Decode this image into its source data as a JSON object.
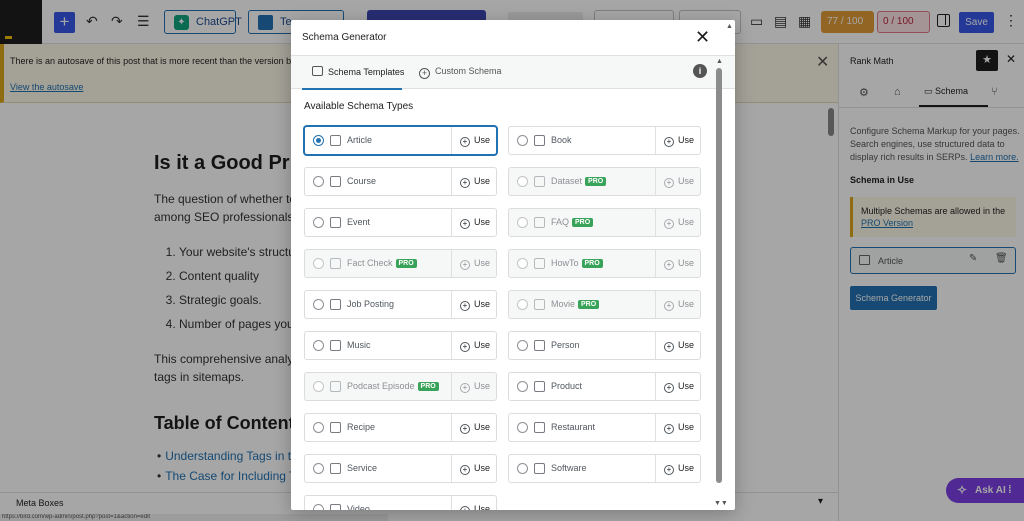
{
  "toolbar": {
    "chatgpt_label": "ChatGPT",
    "template_label": "Te",
    "seo_score": "77 / 100",
    "readability_score": "0 / 100",
    "save_label": "Save"
  },
  "notice": {
    "text": "There is an autosave of this post that is more recent than the version below.",
    "link": "View the autosave"
  },
  "post": {
    "heading": "Is it a Good Pr",
    "intro": "The question of whether to",
    "intro2": "among SEO professionals,",
    "list": [
      "Your website's structu",
      "Content quality",
      "Strategic goals.",
      "Number of pages you"
    ],
    "para": "This comprehensive analy",
    "para2": "tags in sitemaps.",
    "toc_heading": "Table of Content",
    "toc_items": [
      "Understanding Tags in the",
      "The Case for Including Ta"
    ]
  },
  "metabar": {
    "label": "Meta Boxes"
  },
  "statusbar": {
    "text": "https://bird.com/wp-admin/post.php?post=1&action=edit"
  },
  "sidebar": {
    "title": "Rank Math",
    "tab_schema": "Schema",
    "description": "Configure Schema Markup for your pages. Search engines, use structured data to display rich results in SERPs.",
    "learn_more": "Learn more.",
    "in_use_heading": "Schema in Use",
    "warning_text": "Multiple Schemas are allowed in the",
    "warning_link": "PRO Version",
    "card_label": "Article",
    "generator_button": "Schema Generator",
    "ask_ai": "Ask AI"
  },
  "modal": {
    "title": "Schema Generator",
    "tab_templates": "Schema Templates",
    "tab_custom": "Custom Schema",
    "subtitle": "Available Schema Types",
    "use_label": "Use",
    "pro_badge": "PRO",
    "schemas": [
      {
        "label": "Article",
        "pro": false,
        "selected": true,
        "icon": "article-icon"
      },
      {
        "label": "Book",
        "pro": false,
        "selected": false,
        "icon": "book-icon"
      },
      {
        "label": "Course",
        "pro": false,
        "selected": false,
        "icon": "course-icon"
      },
      {
        "label": "Dataset",
        "pro": true,
        "selected": false,
        "icon": "dataset-icon"
      },
      {
        "label": "Event",
        "pro": false,
        "selected": false,
        "icon": "event-icon"
      },
      {
        "label": "FAQ",
        "pro": true,
        "selected": false,
        "icon": "faq-icon"
      },
      {
        "label": "Fact Check",
        "pro": true,
        "selected": false,
        "icon": "fact-check-icon"
      },
      {
        "label": "HowTo",
        "pro": true,
        "selected": false,
        "icon": "howto-icon"
      },
      {
        "label": "Job Posting",
        "pro": false,
        "selected": false,
        "icon": "job-posting-icon"
      },
      {
        "label": "Movie",
        "pro": true,
        "selected": false,
        "icon": "movie-icon"
      },
      {
        "label": "Music",
        "pro": false,
        "selected": false,
        "icon": "music-icon"
      },
      {
        "label": "Person",
        "pro": false,
        "selected": false,
        "icon": "person-icon"
      },
      {
        "label": "Podcast Episode",
        "pro": true,
        "selected": false,
        "icon": "podcast-icon"
      },
      {
        "label": "Product",
        "pro": false,
        "selected": false,
        "icon": "product-icon"
      },
      {
        "label": "Recipe",
        "pro": false,
        "selected": false,
        "icon": "recipe-icon"
      },
      {
        "label": "Restaurant",
        "pro": false,
        "selected": false,
        "icon": "restaurant-icon"
      },
      {
        "label": "Service",
        "pro": false,
        "selected": false,
        "icon": "service-icon"
      },
      {
        "label": "Software",
        "pro": false,
        "selected": false,
        "icon": "software-icon"
      },
      {
        "label": "Video",
        "pro": false,
        "selected": false,
        "icon": "video-icon"
      }
    ]
  },
  "colors": {
    "accent": "#2271b1",
    "wp_blue": "#3858e9",
    "pro_badge": "#3aa35a",
    "ask_ai": "#7b3fe4"
  }
}
